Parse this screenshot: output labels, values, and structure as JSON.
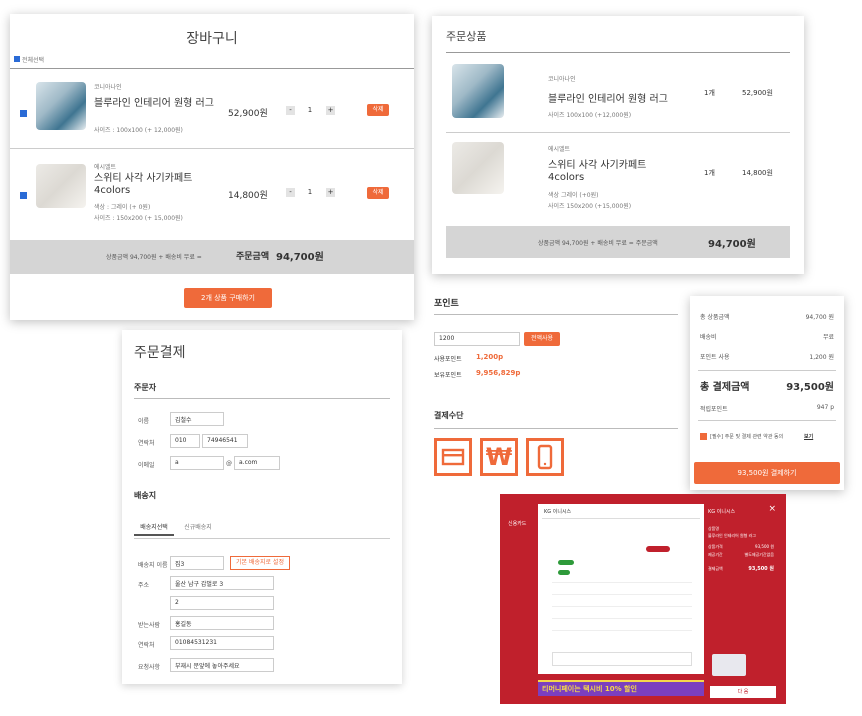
{
  "cart": {
    "title": "장바구니",
    "select_all": "전체선택",
    "items": [
      {
        "brand": "코니아나인",
        "name": "블루라인 인테리어 원형 러그",
        "option": "사이즈 : 100x100 (+ 12,000원)",
        "price": "52,900원",
        "qty": "1",
        "delete": "삭제"
      },
      {
        "brand": "에시엘트",
        "name": "스위티 사각 사기카페트 4colors",
        "option1": "색상 : 그레이 (+ 0원)",
        "option2": "사이즈 : 150x200 (+ 15,000원)",
        "price": "14,800원",
        "qty": "1",
        "delete": "삭제"
      }
    ],
    "summary_prefix": "상품금액 94,700원  +  배송비 무료  =",
    "summary_label": "주문금액",
    "summary_total": "94,700원",
    "buy_button": "2개 상품 구매하기"
  },
  "order_items": {
    "title": "주문상품",
    "items": [
      {
        "brand": "코니아나인",
        "name": "블루라인 인테리어 원형 러그",
        "option": "사이즈 100x100 (+12,000원)",
        "qty": "1개",
        "price": "52,900원"
      },
      {
        "brand": "에시엘트",
        "name": "스위티 사각 사기카페트 4colors",
        "option1": "색상 그레이 (+0원)",
        "option2": "사이즈 150x200 (+15,000원)",
        "qty": "1개",
        "price": "14,800원"
      }
    ],
    "summary_prefix": "상품금액 94,700원  +  배송비 무료  =  주문금액",
    "summary_total": "94,700원"
  },
  "checkout": {
    "title": "주문결제",
    "orderer": "주문자",
    "name_label": "이름",
    "name_value": "김철수",
    "phone_label": "연락처",
    "phone1": "010",
    "phone2": "74946541",
    "email_label": "이메일",
    "email1": "a",
    "email_at": "@",
    "email2": "a.com",
    "shipping": "배송지",
    "tab1": "배송지선택",
    "tab2": "신규배송지",
    "addr_name_label": "배송지 이름",
    "addr_name_value": "집3",
    "default_button": "기본 배송지로 설정",
    "address_label": "주소",
    "address1": "울산 남구 갑벌로 3",
    "address2": "2",
    "receiver_label": "받는사람",
    "receiver_value": "홍길동",
    "contact_label": "연락처",
    "contact_value": "01084531231",
    "request_label": "요청사항",
    "request_value": "부재시 문앞에 놓아주세요"
  },
  "points": {
    "title": "포인트",
    "input_value": "1200",
    "use_button": "전액사용",
    "use_label": "사용포인트",
    "use_value": "1,200p",
    "have_label": "보유포인트",
    "have_value": "9,956,829p",
    "payment_title": "결제수단"
  },
  "total": {
    "rows": [
      {
        "label": "총 상품금액",
        "value": "94,700 원"
      },
      {
        "label": "배송비",
        "value": "무료"
      },
      {
        "label": "포인트 사용",
        "value": "1,200 원"
      }
    ],
    "total_label": "총 결제금액",
    "total_value": "93,500원",
    "earn_label": "적립포인트",
    "earn_value": "947 p",
    "agree_text": "[필수] 주문 및 결제 관련 약관 동의",
    "agree_link": "보기",
    "pay_button": "93,500원 결제하기"
  },
  "kg": {
    "left_label": "신용카드",
    "header": "KG 이니시스",
    "right_header": "KG 이니시스",
    "right_label1": "상품명",
    "right_value1": "블루라인 인테리어 원형 러그",
    "right_label2": "상품가격",
    "right_value2": "93,500 원",
    "right_label3": "제공기간",
    "right_value3": "별도제공기간없음",
    "right_total_label": "결제금액",
    "right_total_value": "93,500 원",
    "banner_text": "티머니페이는 택시비 10% 할인",
    "next_button": "다 음"
  },
  "colors": {
    "accent": "#ef6a3a",
    "kg_red": "#c0202c",
    "summary_gray": "#d5d5d5"
  }
}
